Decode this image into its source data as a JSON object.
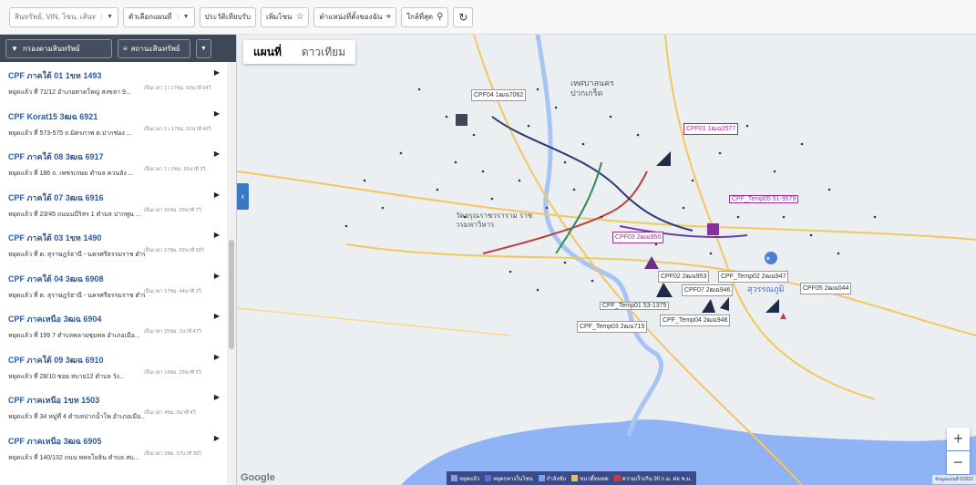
{
  "toolbar": {
    "search_placeholder": "สินทรัพย์, VIN, โซน, เส้นทาง...",
    "options_label": "ตัวเลือกแผนที่",
    "compare_label": "ประวัติเทียบรับ",
    "add_zone_label": "เพิ่มโซน",
    "my_location_label": "ตำแหน่งที่ตั้งของฉัน",
    "nearest_label": "ใกล้ที่สุด"
  },
  "left_panel": {
    "filter_label": "กรองตามสินทรัพย์",
    "sort_label": "สถานะสินทรัพย์",
    "items": [
      {
        "name": "CPF ภาคใต้ 01 1ขห 1493",
        "addr": "หยุดแล้ว ที่ 71/12 อำเภอหาดใหญ่ สงขลา 9...",
        "dur": "เป็นเวลา 1ว 17ชม. 50นาที 54วิ"
      },
      {
        "name": "CPF Korat15 3ฒฉ 6921",
        "addr": "หยุดแล้ว ที่ 573-575 ถ.มิตรภาพ ต.ปากช่อง ...",
        "dur": "เป็นเวลา 1ว 17ชม. 51นาที 46วิ"
      },
      {
        "name": "CPF ภาคใต้ 08 3ฒฉ 6917",
        "addr": "หยุดแล้ว ที่ 186 ถ. เพชรเกษม ตำบล ควนลัง ...",
        "dur": "เป็นเวลา 1ว 2ชม. 16นาที 3วิ"
      },
      {
        "name": "CPF ภาคใต้ 07 3ฒฉ 6916",
        "addr": "หยุดแล้ว ที่ 23/45 ถนนนบีริสร 1 ตำบล ปากพูน ...",
        "dur": "เป็นเวลา 16ชม. 29นาที 7วิ"
      },
      {
        "name": "CPF ภาคใต้ 03 1ขห 1490",
        "addr": "หยุดแล้ว ที่ ต. สุราษฎร์ธานี - นครศรีธรรมราช ตำบล...",
        "dur": "เป็นเวลา 17ชม. 52นาที 59วิ"
      },
      {
        "name": "CPF ภาคใต้ 04 3ฒฉ 6908",
        "addr": "หยุดแล้ว ที่ ต. สุราษฎร์ธานี - นครศรีธรรมราช ตำบล...",
        "dur": "เป็นเวลา 17ชม. 44นาที 3วิ"
      },
      {
        "name": "CPF ภาคเหนือ 3ฒฉ 6904",
        "addr": "หยุดแล้ว ที่ 199 7 ตำบลพลายชุมพล อำเภอเมือ...",
        "dur": "เป็นเวลา 15ชม. 1นาที 47วิ"
      },
      {
        "name": "CPF ภาคใต้ 09 3ฒฉ 6910",
        "addr": "หยุดแล้ว ที่ 28/10 ซอย สบาย12 ตำบล วัง...",
        "dur": "เป็นเวลา 14ชม. 29นาที 5วิ"
      },
      {
        "name": "CPF ภาคเหนือ 1ขห 1503",
        "addr": "หยุดแล้ว ที่ 34 หมู่ที่ 4 ตำบลปากน้ำโพ อำเภอเมือ...",
        "dur": "เป็นเวลา 4ชม. 9นาที 4วิ"
      },
      {
        "name": "CPF ภาคเหนือ 3ฒฉ 6905",
        "addr": "หยุดแล้ว ที่ 140/132 ถนน พหลโยธิน ตำบล สบ...",
        "dur": "เป็นเวลา 2ชม. 57นาที 39วิ"
      }
    ]
  },
  "map": {
    "tab_map": "แผนที่",
    "tab_satellite": "ดาวเทียม",
    "zoom_in": "+",
    "zoom_out": "−",
    "google": "Google",
    "attribution": "ข้อมูลแผนที่ ©2022",
    "vehicles": [
      {
        "label": "CPF04 1ฒฉ7062",
        "style": "plain"
      },
      {
        "label": "CPF01 1ฒฉ2577",
        "style": "purple"
      },
      {
        "label": "CPF_Temp05 51-9579",
        "style": "purple"
      },
      {
        "label": "CPF03 2ฒฉ950",
        "style": "purple"
      },
      {
        "label": "CPF02 2ฒฉ953",
        "style": "plain"
      },
      {
        "label": "CPF_Temp02 2ฒฉ947",
        "style": "plain"
      },
      {
        "label": "CPF05 2ฒฉ044",
        "style": "plain"
      },
      {
        "label": "CPF07 2ฒฉ946",
        "style": "plain"
      },
      {
        "label": "CPF_Temp01 53-1375",
        "style": "plain"
      },
      {
        "label": "CPF_Temp04 2ฒฉ948",
        "style": "plain"
      },
      {
        "label": "CPF_Temp03 2ฒฉ715",
        "style": "plain"
      }
    ],
    "places": [
      "เทศบาลนคร ปากเกร็ด",
      "สุวรรณภูมิ",
      "วัดอรุณราชวราราม ราชวรมหาวิหาร"
    ],
    "legend": [
      {
        "label": "หยุดแล้ว",
        "color": "#8e9ad8"
      },
      {
        "label": "หยุดกลางในโซน",
        "color": "#5a6fd0"
      },
      {
        "label": "กำลังขับ",
        "color": "#6fa0ff"
      },
      {
        "label": "ขนาดิ์ทนทด",
        "color": "#f0c040"
      },
      {
        "label": "ความเร็วเกิน 90 ก.ม. ต่อ ช.ม.",
        "color": "#d23b3b"
      }
    ]
  }
}
